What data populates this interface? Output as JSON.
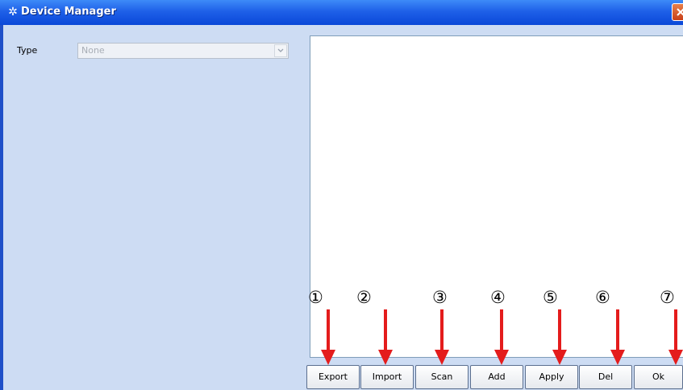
{
  "window": {
    "title": "Device Manager",
    "title_icon": "gear-icon"
  },
  "type_field": {
    "label": "Type",
    "value": "None"
  },
  "buttons": [
    {
      "id": "export",
      "label": "Export",
      "marker": "①"
    },
    {
      "id": "import",
      "label": "Import",
      "marker": "②"
    },
    {
      "id": "scan",
      "label": "Scan",
      "marker": "③"
    },
    {
      "id": "add",
      "label": "Add",
      "marker": "④"
    },
    {
      "id": "apply",
      "label": "Apply",
      "marker": "⑤"
    },
    {
      "id": "del",
      "label": "Del",
      "marker": "⑥"
    },
    {
      "id": "ok",
      "label": "Ok",
      "marker": "⑦"
    }
  ],
  "colors": {
    "annotation_arrow": "#e41c1c",
    "titlebar": "#1f60e8",
    "panel": "#cddcf3"
  }
}
